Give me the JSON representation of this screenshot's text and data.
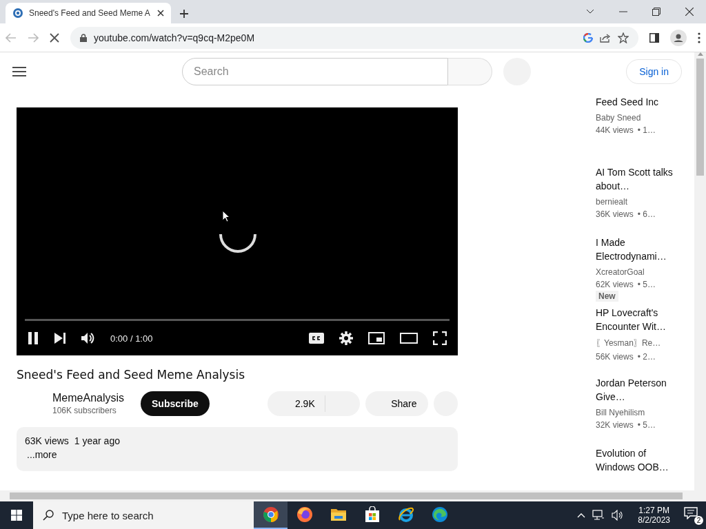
{
  "browser": {
    "tabs": [
      {
        "title": "Sneed's Feed and Seed Meme A",
        "selected": true
      }
    ],
    "url": "youtube.com/watch?v=q9cq-M2pe0M",
    "loading": true
  },
  "header": {
    "search": {
      "placeholder": "Search"
    },
    "sign_in": "Sign in"
  },
  "video": {
    "playing": true,
    "progress": {
      "level": 0
    },
    "time": "0:00 / 1:00"
  },
  "title": "Sneed's Feed and Seed Meme Analysis",
  "channel": {
    "name": "MemeAnalysis",
    "subscribers": "106K subscribers",
    "subscribe": "Subscribe"
  },
  "actions": {
    "likes": "2.9K",
    "share": "Share"
  },
  "description": {
    "views": "63K views",
    "date": "1 year ago",
    "more": "...more"
  },
  "related": [
    {
      "title": "Feed Seed Inc",
      "channel": "Baby Sneed",
      "views": "44K views",
      "age": "• 1…"
    },
    {
      "title": "AI Tom Scott talks about…",
      "channel": "berniealt",
      "views": "36K views",
      "age": "• 6…"
    },
    {
      "title": "I Made Electrodynami…",
      "channel": "XcreatorGoal",
      "views": "62K views",
      "age": "• 5…",
      "badge": "New"
    },
    {
      "title": "HP Lovecraft's Encounter Wit…",
      "channel": "〖Yesman〗Re…",
      "views": "56K views",
      "age": "• 2…"
    },
    {
      "title": "Jordan Peterson Give…",
      "channel": "Bill Nyehilism",
      "views": "32K views",
      "age": "• 5…"
    },
    {
      "title": "Evolution of Windows OOB…"
    }
  ],
  "taskbar": {
    "search": {
      "placeholder": "Type here to search"
    },
    "apps": [
      {
        "kind": "chrome",
        "active": true
      },
      {
        "kind": "firefox",
        "active": false
      },
      {
        "kind": "folder",
        "active": false
      },
      {
        "kind": "store",
        "active": false
      },
      {
        "kind": "ie",
        "active": false
      },
      {
        "kind": "edge",
        "active": false
      }
    ],
    "time": "1:27 PM",
    "date": "8/2/2023",
    "notifications": "2"
  }
}
